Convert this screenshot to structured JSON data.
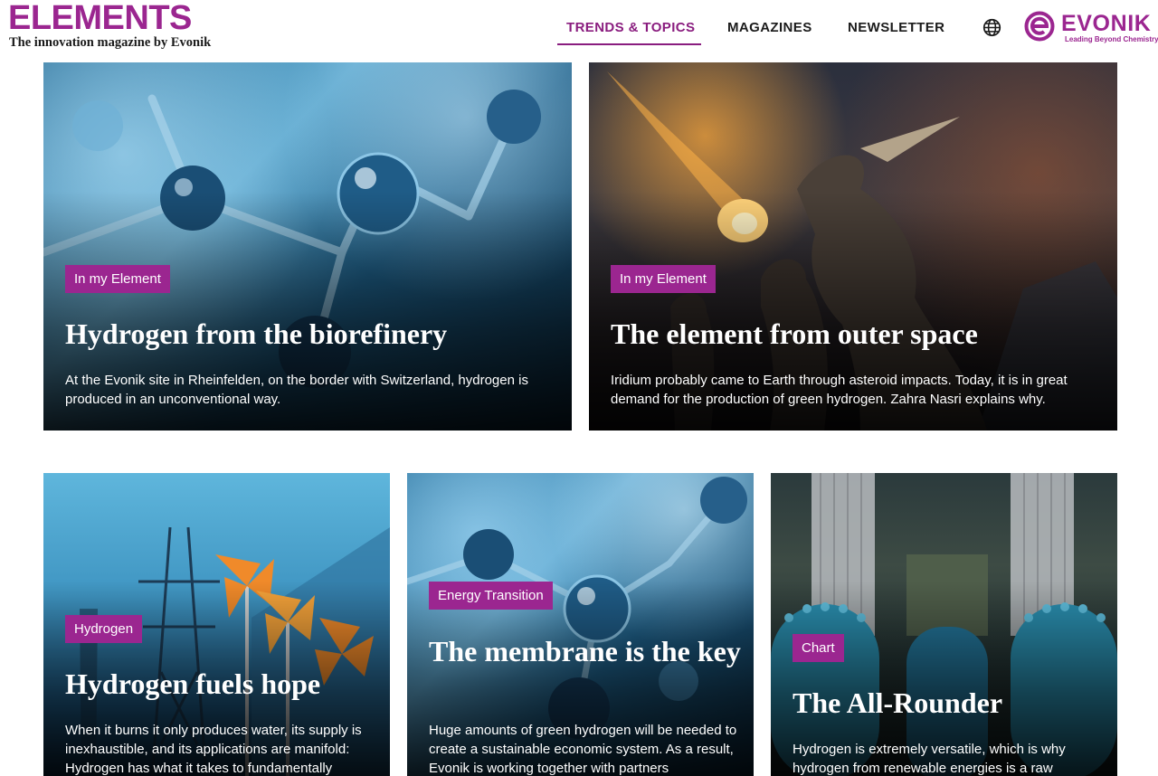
{
  "brand": {
    "title": "ELEMENTS",
    "subtitle": "The innovation magazine by Evonik"
  },
  "nav": {
    "items": [
      {
        "label": "TRENDS & TOPICS",
        "active": true
      },
      {
        "label": "MAGAZINES",
        "active": false
      },
      {
        "label": "NEWSLETTER",
        "active": false
      }
    ],
    "language_icon": "globe-icon"
  },
  "logo": {
    "name": "EVONIK",
    "tagline": "Leading Beyond Chemistry"
  },
  "colors": {
    "accent": "#9b2690",
    "nav_active": "#8a1d7f"
  },
  "cards": [
    {
      "tag": "In my Element",
      "title": "Hydrogen from the biorefinery",
      "description": "At the Evonik site in Rheinfelden, on the border with Switzerland, hydrogen is produced in an unconventional way."
    },
    {
      "tag": "In my Element",
      "title": "The element from outer space",
      "description": "Iridium probably came to Earth through asteroid impacts. Today, it is in great demand for the production of green hydrogen. Zahra Nasri explains why."
    },
    {
      "tag": "Hydrogen",
      "title": "Hydrogen fuels hope",
      "description": "When it burns it only produces water, its supply is inexhaustible, and its applications are manifold: Hydrogen has what it takes to fundamentally"
    },
    {
      "tag": "Energy Transition",
      "title": "The membrane is the key",
      "description": "Huge amounts of green hydrogen will be needed to create a sustainable economic system. As a result, Evonik is working together with partners"
    },
    {
      "tag": "Chart",
      "title": "The All-Rounder",
      "description": "Hydrogen is extremely versatile, which is why hydrogen from renewable energies is a raw"
    }
  ]
}
